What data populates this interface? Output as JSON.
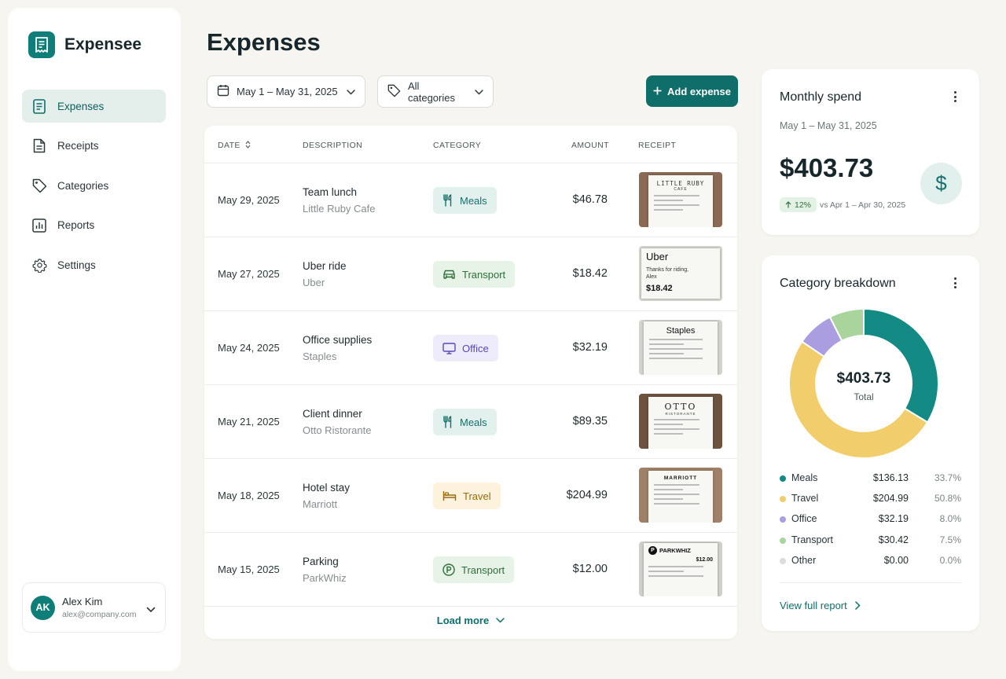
{
  "app": {
    "name": "Expensee"
  },
  "nav": [
    {
      "label": "Expenses",
      "icon": "expenses-icon",
      "active": true
    },
    {
      "label": "Receipts",
      "icon": "receipt-icon",
      "active": false
    },
    {
      "label": "Categories",
      "icon": "tag-icon",
      "active": false
    },
    {
      "label": "Reports",
      "icon": "chart-icon",
      "active": false
    },
    {
      "label": "Settings",
      "icon": "gear-icon",
      "active": false
    }
  ],
  "user": {
    "initials": "AK",
    "name": "Alex Kim",
    "email": "alex@company.com"
  },
  "page": {
    "title": "Expenses"
  },
  "filters": {
    "date_range": "May 1 – May 31, 2025",
    "category": "All categories"
  },
  "actions": {
    "add_expense": "Add expense",
    "load_more": "Load more"
  },
  "table": {
    "columns": {
      "date": "DATE",
      "description": "DESCRIPTION",
      "category": "CATEGORY",
      "amount": "AMOUNT",
      "receipt": "RECEIPT"
    },
    "rows": [
      {
        "date": "May 29, 2025",
        "title": "Team lunch",
        "merchant": "Little Ruby Cafe",
        "category": "Meals",
        "amount": "$46.78",
        "receipt_header": "LITTLE RUBY",
        "receipt_sub": "CAFE"
      },
      {
        "date": "May 27, 2025",
        "title": "Uber ride",
        "merchant": "Uber",
        "category": "Transport",
        "amount": "$18.42",
        "receipt_header": "Uber",
        "receipt_sub": "Thanks for riding, Alex",
        "receipt_total": "$18.42"
      },
      {
        "date": "May 24, 2025",
        "title": "Office supplies",
        "merchant": "Staples",
        "category": "Office",
        "amount": "$32.19",
        "receipt_header": "Staples",
        "receipt_sub": ""
      },
      {
        "date": "May 21, 2025",
        "title": "Client dinner",
        "merchant": "Otto Ristorante",
        "category": "Meals",
        "amount": "$89.35",
        "receipt_header": "OTTO",
        "receipt_sub": "RISTORANTE"
      },
      {
        "date": "May 18, 2025",
        "title": "Hotel stay",
        "merchant": "Marriott",
        "category": "Travel",
        "amount": "$204.99",
        "receipt_header": "MARRIOTT",
        "receipt_sub": ""
      },
      {
        "date": "May 15, 2025",
        "title": "Parking",
        "merchant": "ParkWhiz",
        "category": "Transport",
        "amount": "$12.00",
        "receipt_header": "PARKWHIZ",
        "receipt_sub": "",
        "receipt_total": "$12.00"
      }
    ]
  },
  "monthly": {
    "title": "Monthly spend",
    "period": "May 1 – May 31, 2025",
    "total": "$403.73",
    "change": "12%",
    "compare": "vs Apr 1 – Apr 30, 2025"
  },
  "breakdown": {
    "title": "Category breakdown",
    "center_value": "$403.73",
    "center_label": "Total",
    "link": "View full report",
    "categories": [
      {
        "name": "Meals",
        "amount": "$136.13",
        "pct": "33.7%",
        "value": 33.7,
        "color": "#148a85"
      },
      {
        "name": "Travel",
        "amount": "$204.99",
        "pct": "50.8%",
        "value": 50.8,
        "color": "#f2cd6b"
      },
      {
        "name": "Office",
        "amount": "$32.19",
        "pct": "8.0%",
        "value": 8.0,
        "color": "#ab9ee0"
      },
      {
        "name": "Transport",
        "amount": "$30.42",
        "pct": "7.5%",
        "value": 7.5,
        "color": "#a9d59d"
      },
      {
        "name": "Other",
        "amount": "$0.00",
        "pct": "0.0%",
        "value": 0.0,
        "color": "#dcdcdc"
      }
    ]
  },
  "colors": {
    "accent": "#0f7d78",
    "accent_dark": "#0f6e6a",
    "background": "#f6f5f0"
  }
}
